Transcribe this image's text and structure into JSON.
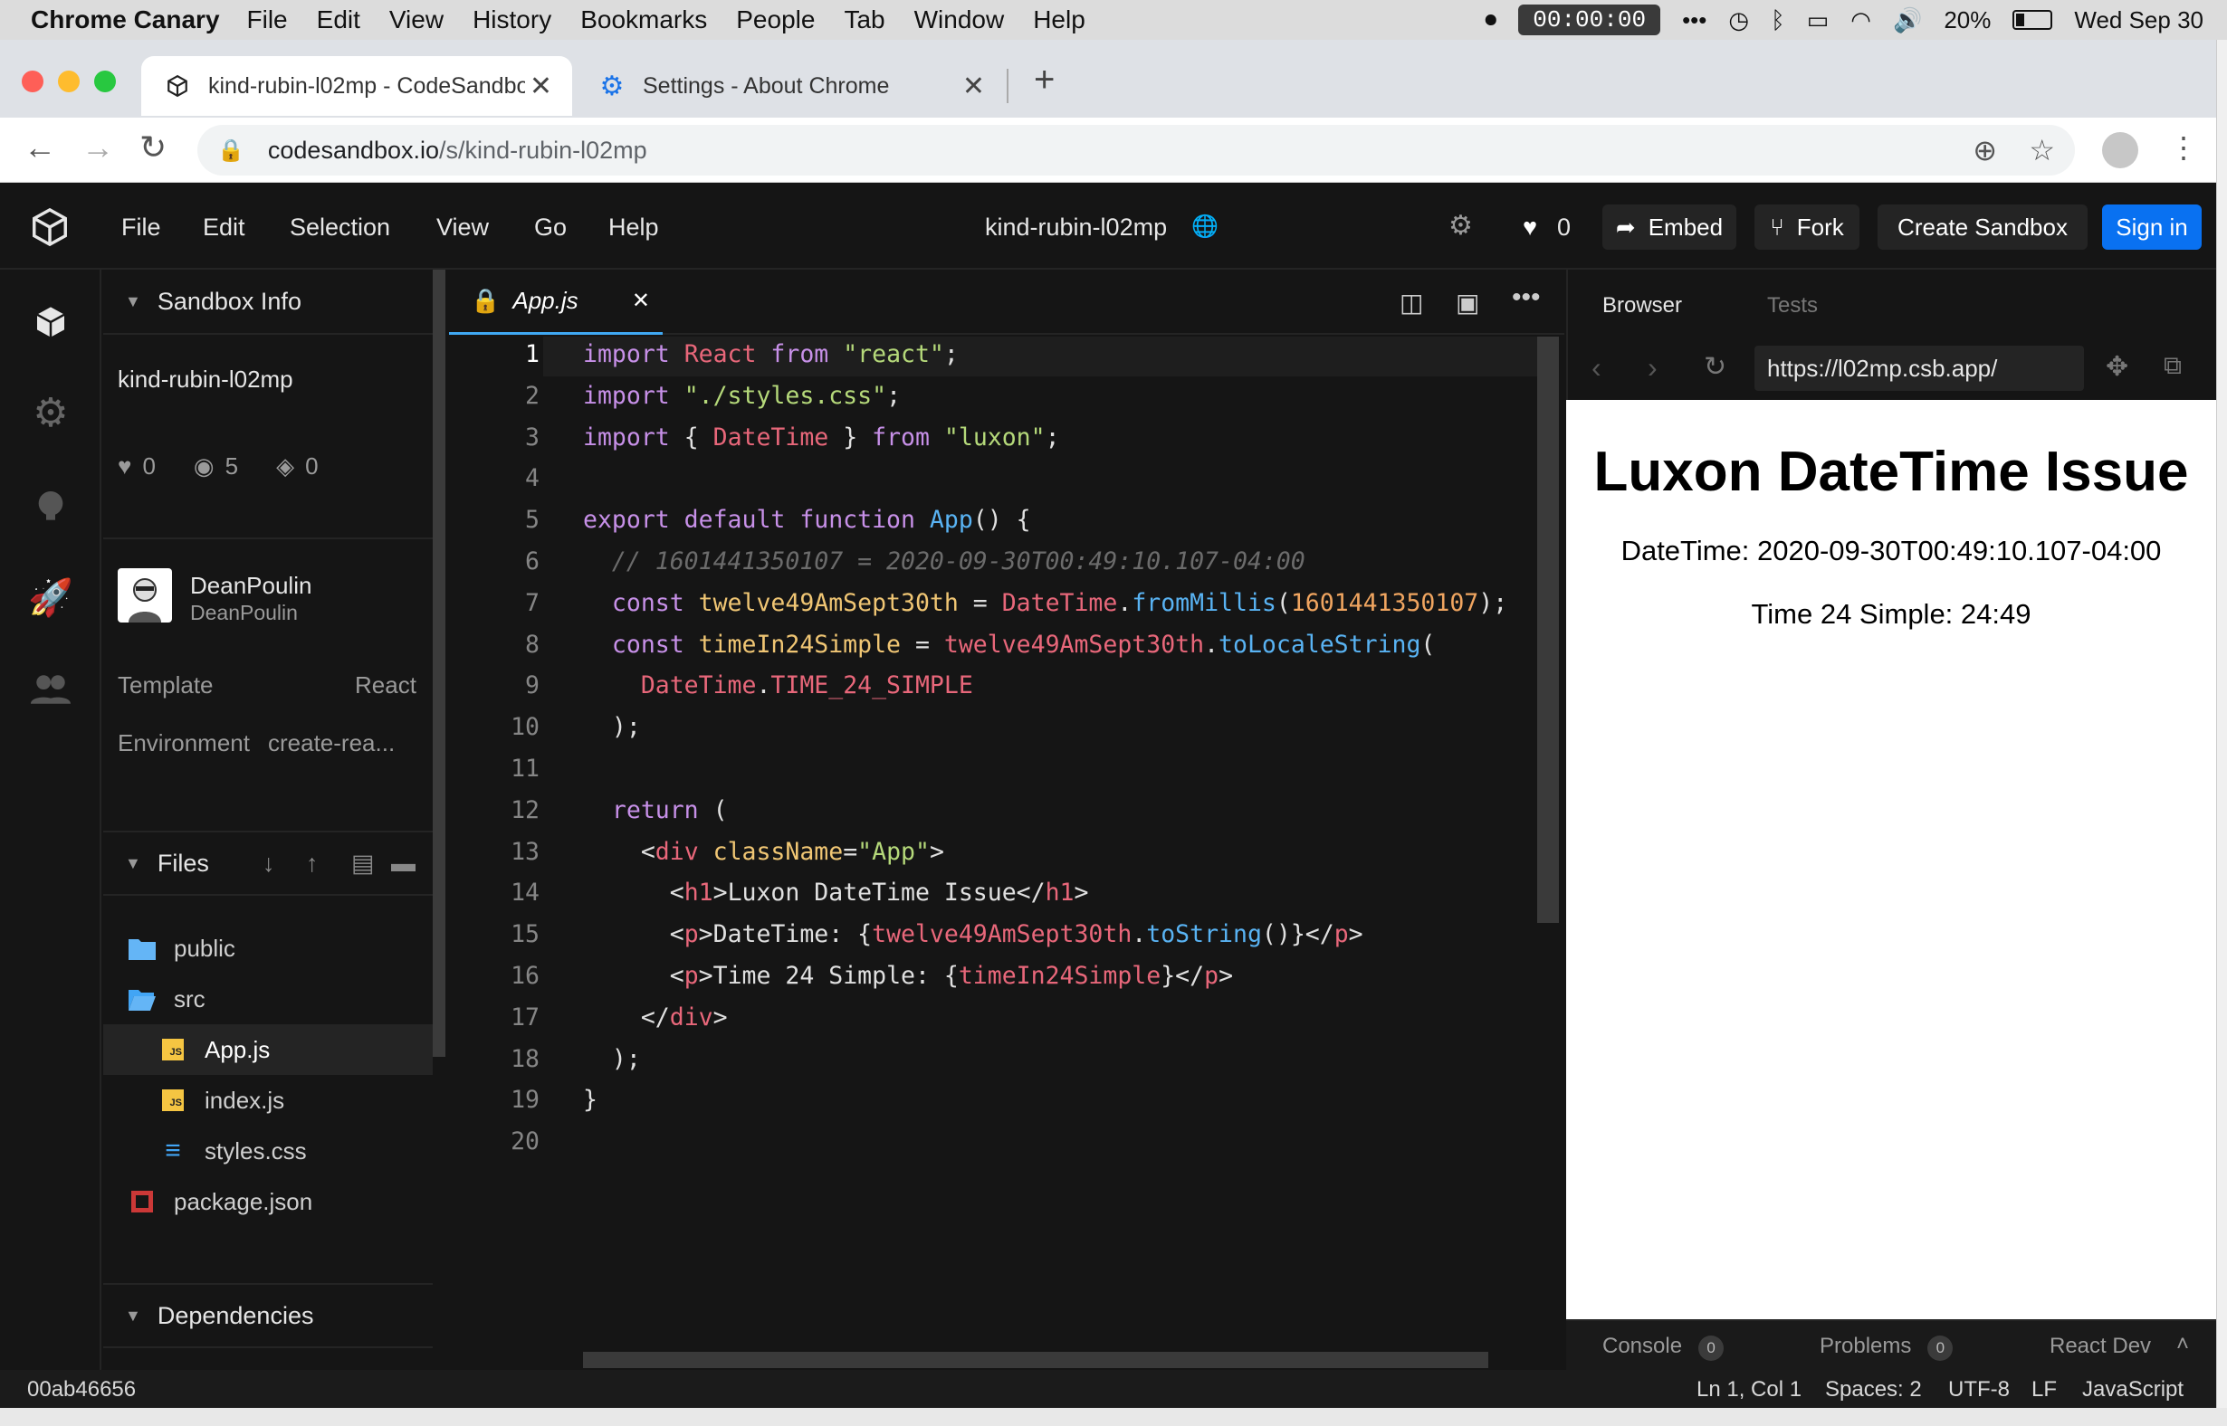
{
  "mac_menubar": {
    "app": "Chrome Canary",
    "items": [
      "File",
      "Edit",
      "View",
      "History",
      "Bookmarks",
      "People",
      "Tab",
      "Window",
      "Help"
    ],
    "recording_time": "00:00:00",
    "battery": "20%",
    "clock": "Wed Sep 30"
  },
  "browser": {
    "tabs": [
      {
        "title": "kind-rubin-l02mp - CodeSandbox",
        "active": true
      },
      {
        "title": "Settings - About Chrome",
        "active": false
      }
    ],
    "url_host": "codesandbox.io",
    "url_path": "/s/kind-rubin-l02mp"
  },
  "csb_header": {
    "menu": [
      "File",
      "Edit",
      "Selection",
      "View",
      "Go",
      "Help"
    ],
    "sandbox_title": "kind-rubin-l02mp",
    "likes": "0",
    "embed_label": "Embed",
    "fork_label": "Fork",
    "create_label": "Create Sandbox",
    "signin_label": "Sign in"
  },
  "sidebar": {
    "info_header": "Sandbox Info",
    "sandbox_name": "kind-rubin-l02mp",
    "likes": "0",
    "views": "5",
    "forks": "0",
    "author_name": "DeanPoulin",
    "author_handle": "DeanPoulin",
    "template_label": "Template",
    "template_value": "React",
    "env_label": "Environment",
    "env_value": "create-rea...",
    "files_header": "Files",
    "files": [
      {
        "name": "public",
        "type": "folder",
        "indent": 0
      },
      {
        "name": "src",
        "type": "folder-open",
        "indent": 0
      },
      {
        "name": "App.js",
        "type": "js",
        "indent": 1,
        "selected": true
      },
      {
        "name": "index.js",
        "type": "js",
        "indent": 1
      },
      {
        "name": "styles.css",
        "type": "css",
        "indent": 1
      },
      {
        "name": "package.json",
        "type": "npm",
        "indent": 0
      }
    ],
    "deps_header": "Dependencies"
  },
  "editor": {
    "tab_label": "App.js",
    "line_numbers": [
      "1",
      "2",
      "3",
      "4",
      "5",
      "6",
      "7",
      "8",
      "9",
      "10",
      "11",
      "12",
      "13",
      "14",
      "15",
      "16",
      "17",
      "18",
      "19",
      "20"
    ],
    "lines": [
      [
        [
          "kw",
          "import "
        ],
        [
          "id",
          "React "
        ],
        [
          "kw",
          "from "
        ],
        [
          "str",
          "\"react\""
        ],
        [
          "pl",
          ";"
        ]
      ],
      [
        [
          "kw",
          "import "
        ],
        [
          "str",
          "\"./styles.css\""
        ],
        [
          "pl",
          ";"
        ]
      ],
      [
        [
          "kw",
          "import "
        ],
        [
          "pl",
          "{ "
        ],
        [
          "id",
          "DateTime"
        ],
        [
          "pl",
          " } "
        ],
        [
          "kw",
          "from "
        ],
        [
          "str",
          "\"luxon\""
        ],
        [
          "pl",
          ";"
        ]
      ],
      [],
      [
        [
          "kw",
          "export default function "
        ],
        [
          "fn",
          "App"
        ],
        [
          "pl",
          "() {"
        ]
      ],
      [
        [
          "cmt",
          "  // 1601441350107 = 2020-09-30T00:49:10.107-04:00"
        ]
      ],
      [
        [
          "kw",
          "  const "
        ],
        [
          "attr",
          "twelve49AmSept30th"
        ],
        [
          "pl",
          " = "
        ],
        [
          "id",
          "DateTime"
        ],
        [
          "pl",
          "."
        ],
        [
          "fn",
          "fromMillis"
        ],
        [
          "pl",
          "("
        ],
        [
          "num",
          "1601441350107"
        ],
        [
          "pl",
          ");"
        ]
      ],
      [
        [
          "kw",
          "  const "
        ],
        [
          "attr",
          "timeIn24Simple"
        ],
        [
          "pl",
          " = "
        ],
        [
          "id",
          "twelve49AmSept30th"
        ],
        [
          "pl",
          "."
        ],
        [
          "fn",
          "toLocaleString"
        ],
        [
          "pl",
          "("
        ]
      ],
      [
        [
          "id",
          "    DateTime"
        ],
        [
          "pl",
          "."
        ],
        [
          "id",
          "TIME_24_SIMPLE"
        ]
      ],
      [
        [
          "pl",
          "  );"
        ]
      ],
      [],
      [
        [
          "kw",
          "  return "
        ],
        [
          "pl",
          "("
        ]
      ],
      [
        [
          "pl",
          "    <"
        ],
        [
          "tag",
          "div "
        ],
        [
          "attr",
          "className"
        ],
        [
          "pl",
          "="
        ],
        [
          "str",
          "\"App\""
        ],
        [
          "pl",
          ">"
        ]
      ],
      [
        [
          "pl",
          "      <"
        ],
        [
          "tag",
          "h1"
        ],
        [
          "pl",
          ">Luxon DateTime Issue</"
        ],
        [
          "tag",
          "h1"
        ],
        [
          "pl",
          ">"
        ]
      ],
      [
        [
          "pl",
          "      <"
        ],
        [
          "tag",
          "p"
        ],
        [
          "pl",
          ">DateTime: {"
        ],
        [
          "id",
          "twelve49AmSept30th"
        ],
        [
          "pl",
          "."
        ],
        [
          "fn",
          "toString"
        ],
        [
          "pl",
          "()}</"
        ],
        [
          "tag",
          "p"
        ],
        [
          "pl",
          ">"
        ]
      ],
      [
        [
          "pl",
          "      <"
        ],
        [
          "tag",
          "p"
        ],
        [
          "pl",
          ">Time 24 Simple: {"
        ],
        [
          "id",
          "timeIn24Simple"
        ],
        [
          "pl",
          "}</"
        ],
        [
          "tag",
          "p"
        ],
        [
          "pl",
          ">"
        ]
      ],
      [
        [
          "pl",
          "    </"
        ],
        [
          "tag",
          "div"
        ],
        [
          "pl",
          ">"
        ]
      ],
      [
        [
          "pl",
          "  );"
        ]
      ],
      [
        [
          "pl",
          "}"
        ]
      ],
      []
    ]
  },
  "preview": {
    "tab_browser": "Browser",
    "tab_tests": "Tests",
    "url": "https://l02mp.csb.app/",
    "heading": "Luxon DateTime Issue",
    "line1": "DateTime: 2020-09-30T00:49:10.107-04:00",
    "line2": "Time 24 Simple: 24:49",
    "console_label": "Console",
    "console_count": "0",
    "problems_label": "Problems",
    "problems_count": "0",
    "react_label": "React Dev"
  },
  "statusbar": {
    "commit": "00ab46656",
    "position": "Ln 1, Col 1",
    "spaces": "Spaces: 2",
    "encoding": "UTF-8",
    "eol": "LF",
    "language": "JavaScript"
  },
  "colors": {
    "accent": "#0971f1",
    "editor_bg": "#151515",
    "tab_indicator": "#40a9f3"
  }
}
